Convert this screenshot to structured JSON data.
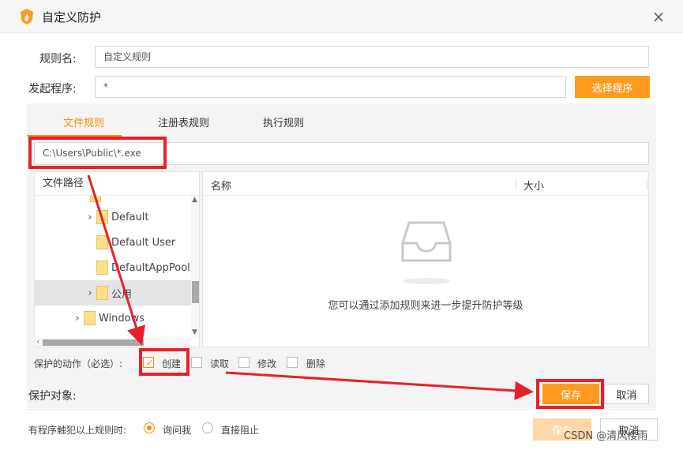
{
  "window": {
    "title": "自定义防护"
  },
  "form": {
    "rule_name_label": "规则名:",
    "rule_name_value": "自定义规则",
    "process_label": "发起程序:",
    "process_value": "*",
    "select_program_button": "选择程序"
  },
  "tabs": [
    {
      "label": "文件规则",
      "active": true
    },
    {
      "label": "注册表规则",
      "active": false
    },
    {
      "label": "执行规则",
      "active": false
    }
  ],
  "path_input_value": "C:\\Users\\Public\\*.exe",
  "tree": {
    "header": "文件路径",
    "items": [
      {
        "label": "Default",
        "expandable": true,
        "selected": false
      },
      {
        "label": "Default User",
        "expandable": false,
        "selected": false
      },
      {
        "label": "DefaultAppPool",
        "expandable": false,
        "selected": false
      },
      {
        "label": "公用",
        "expandable": true,
        "selected": true
      },
      {
        "label": "Windows",
        "expandable": true,
        "selected": false
      }
    ]
  },
  "filelist": {
    "col_name": "名称",
    "col_size": "大小",
    "empty_message": "您可以通过添加规则来进一步提升防护等级"
  },
  "actions": {
    "label": "保护的动作（必选）:",
    "options": [
      {
        "label": "创建",
        "checked": true
      },
      {
        "label": "读取",
        "checked": false
      },
      {
        "label": "修改",
        "checked": false
      },
      {
        "label": "删除",
        "checked": false
      }
    ]
  },
  "protect_target_label": "保护对象:",
  "inner_buttons": {
    "save": "保存",
    "cancel": "取消"
  },
  "violation": {
    "label": "有程序触犯以上规则时:",
    "options": [
      {
        "label": "询问我",
        "selected": true
      },
      {
        "label": "直接阻止",
        "selected": false
      }
    ]
  },
  "footer_buttons": {
    "save": "保存",
    "cancel": "取消"
  },
  "watermark": "CSDN @清风楼雨",
  "colors": {
    "accent": "#ff9a1f",
    "annotation": "#e8202a"
  }
}
